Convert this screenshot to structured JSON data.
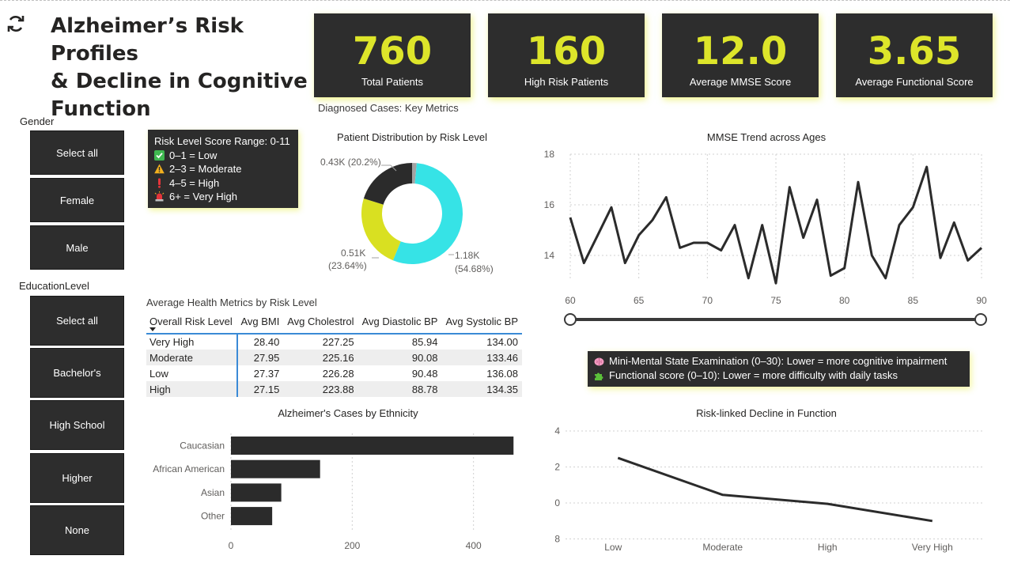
{
  "header": {
    "title_line1": "Alzheimer’s Risk Profiles",
    "title_line2": "& Decline in Cognitive",
    "title_line3": "Function",
    "refresh_icon": "refresh-icon"
  },
  "kpis": [
    {
      "value": "760",
      "label": "Total Patients"
    },
    {
      "value": "160",
      "label": "High Risk Patients"
    },
    {
      "value": "12.0",
      "label": "Average MMSE Score"
    },
    {
      "value": "3.65",
      "label": "Average Functional Score"
    }
  ],
  "kpi_caption": "Diagnosed Cases: Key Metrics",
  "colors": {
    "accent": "#dde52a",
    "card": "#2d2d2d",
    "cyan": "#36e3e6",
    "yellow_green": "#d9e021",
    "dark": "#2b2b2b",
    "gray": "#a3a3a3"
  },
  "gender_slicer": {
    "title": "Gender",
    "items": [
      "Select all",
      "Female",
      "Male"
    ]
  },
  "education_slicer": {
    "title": "EducationLevel",
    "items": [
      "Select all",
      "Bachelor's",
      "High School",
      "Higher",
      "None"
    ]
  },
  "risk_legend": {
    "title": "Risk Level Score Range: 0-11",
    "items": [
      {
        "icon": "check-icon",
        "text": "0–1 = Low"
      },
      {
        "icon": "warning-icon",
        "text": "2–3 = Moderate"
      },
      {
        "icon": "exclamation-icon",
        "text": "4–5 = High"
      },
      {
        "icon": "siren-icon",
        "text": "6+ = Very High"
      }
    ]
  },
  "notes": [
    {
      "icon": "brain-icon",
      "text": "Mini-Mental State Examination (0–30): Lower = more cognitive impairment"
    },
    {
      "icon": "puzzle-icon",
      "text": "Functional score (0–10): Lower = more difficulty with daily tasks"
    }
  ],
  "metrics_table": {
    "title": "Average Health Metrics by Risk Level",
    "columns": [
      "Overall Risk Level",
      "Avg BMI",
      "Avg Cholestrol",
      "Avg Diastolic BP",
      "Avg Systolic BP"
    ],
    "rows": [
      [
        "Very High",
        "28.40",
        "227.25",
        "85.94",
        "134.00"
      ],
      [
        "Moderate",
        "27.95",
        "225.16",
        "90.08",
        "133.46"
      ],
      [
        "Low",
        "27.37",
        "226.28",
        "90.48",
        "136.08"
      ],
      [
        "High",
        "27.15",
        "223.88",
        "88.78",
        "134.35"
      ]
    ]
  },
  "chart_data": [
    {
      "type": "pie",
      "title": "Patient Distribution by Risk Level",
      "slices": [
        {
          "value": 0.43,
          "percent": 20.2,
          "label": "0.43K (20.2%)",
          "color": "#2b2b2b"
        },
        {
          "value": 0.51,
          "percent": 23.64,
          "label": "0.51K",
          "label2": "(23.64%)",
          "color": "#d9e021"
        },
        {
          "value": 1.18,
          "percent": 54.68,
          "label": "1.18K",
          "label2": "(54.68%)",
          "color": "#36e3e6"
        },
        {
          "value": 0.03,
          "percent": 1.48,
          "label": "",
          "color": "#a3a3a3"
        }
      ]
    },
    {
      "type": "line",
      "title": "MMSE Trend across Ages",
      "xlabel": "",
      "ylabel": "",
      "xlim": [
        60,
        90
      ],
      "ylim": [
        13,
        18
      ],
      "x_ticks": [
        "60",
        "65",
        "70",
        "75",
        "80",
        "85",
        "90"
      ],
      "y_ticks": [
        "14",
        "16",
        "18"
      ],
      "grid": true,
      "x": [
        60,
        61,
        62,
        63,
        64,
        65,
        66,
        67,
        68,
        69,
        70,
        71,
        72,
        73,
        74,
        75,
        76,
        77,
        78,
        79,
        80,
        81,
        82,
        83,
        84,
        85,
        86,
        87,
        88,
        89,
        90
      ],
      "y": [
        15.5,
        13.7,
        14.8,
        15.9,
        13.7,
        14.8,
        15.4,
        16.3,
        14.3,
        14.5,
        14.5,
        14.2,
        15.2,
        13.1,
        15.2,
        12.9,
        16.7,
        14.7,
        16.2,
        13.2,
        13.5,
        16.9,
        14.0,
        13.1,
        15.2,
        15.9,
        17.5,
        13.9,
        15.3,
        13.8,
        14.3
      ]
    },
    {
      "type": "bar",
      "orientation": "horizontal",
      "title": "Alzheimer's Cases by Ethnicity",
      "categories": [
        "Caucasian",
        "African American",
        "Asian",
        "Other"
      ],
      "values": [
        466,
        147,
        83,
        68
      ],
      "xlim": [
        0,
        480
      ],
      "x_ticks": [
        "0",
        "200",
        "400"
      ],
      "grid": true
    },
    {
      "type": "line",
      "title": "Risk-linked Decline in Function",
      "categories": [
        "Low",
        "Moderate",
        "High",
        "Very High"
      ],
      "values": [
        2.5,
        0.45,
        -0.05,
        -1.0
      ],
      "y_ticks": [
        "4",
        "2",
        "0",
        "8"
      ],
      "ylim": [
        -2,
        4
      ],
      "grid": true
    }
  ],
  "age_slider": {
    "min": 60,
    "max": 90
  }
}
